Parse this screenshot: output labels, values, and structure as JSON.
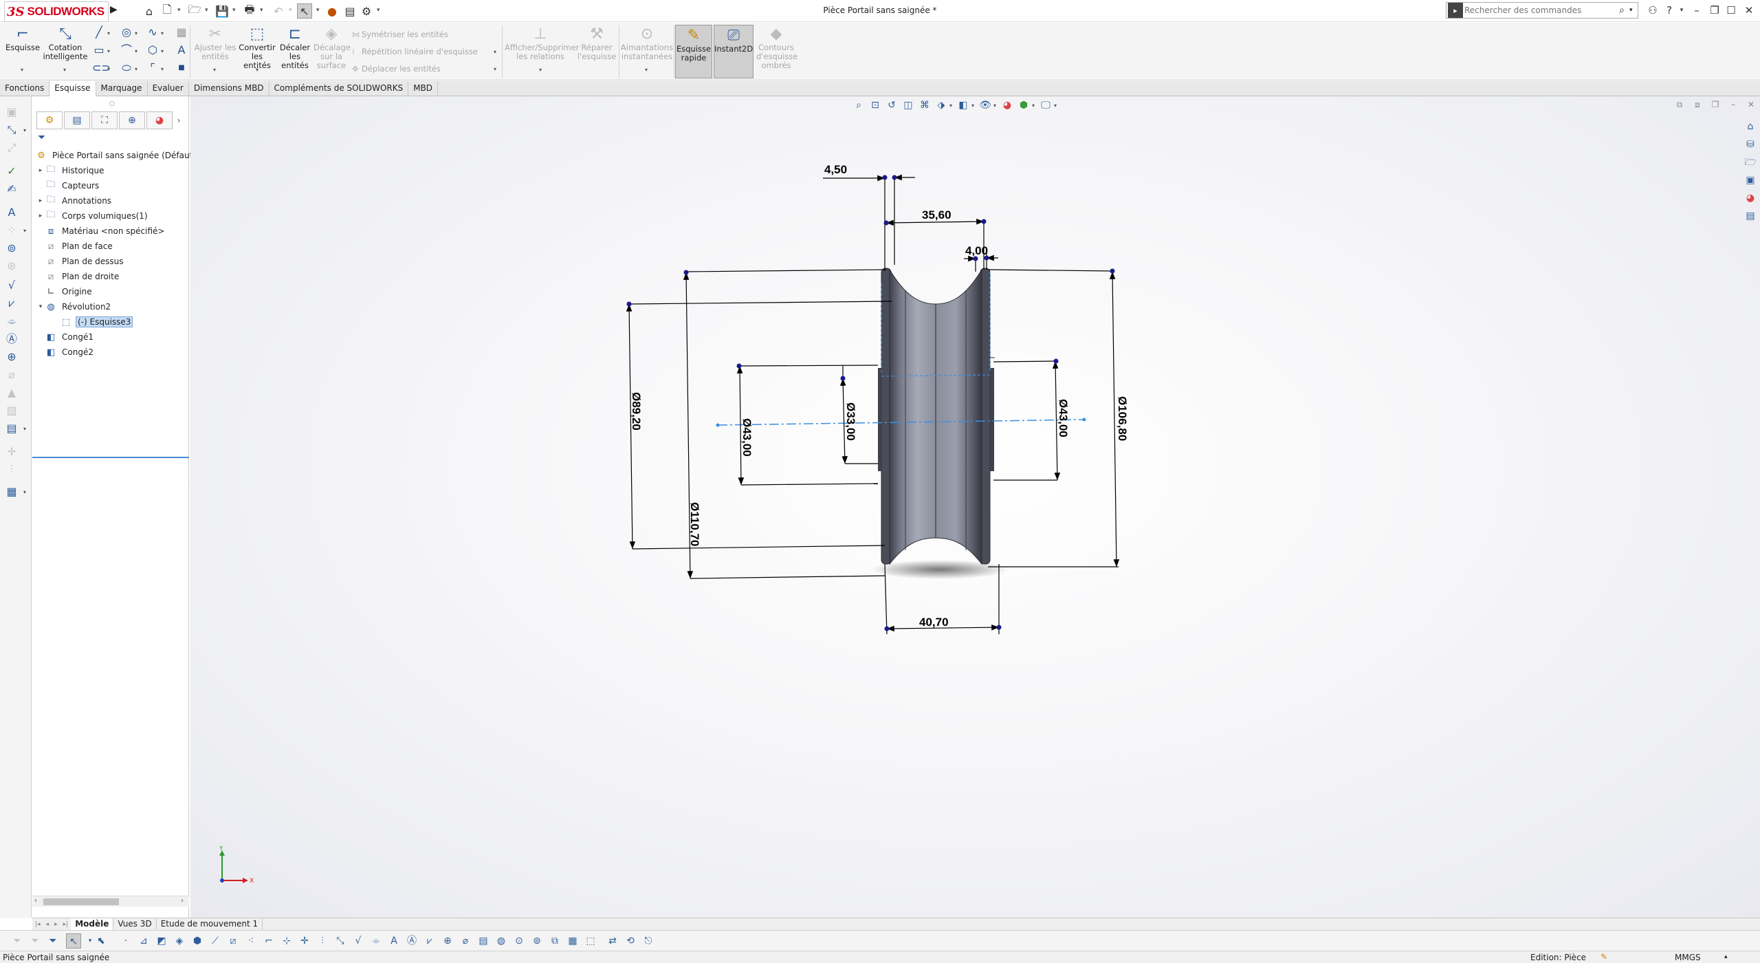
{
  "app": {
    "logo_ds": "3S",
    "logo_name": "SOLIDWORKS",
    "document_title": "Pièce Portail sans saignée *"
  },
  "search": {
    "placeholder": "Rechercher des commandes"
  },
  "ribbon": {
    "sketch": "Esquisse",
    "smart_dimension": [
      "Cotation",
      "intelligente"
    ],
    "trim": [
      "Ajuster les",
      "entités"
    ],
    "convert": [
      "Convertir",
      "les entités"
    ],
    "offset": [
      "Décaler",
      "les",
      "entités"
    ],
    "offset_surface": [
      "Décalage",
      "sur la",
      "surface"
    ],
    "mirror": "Symétriser les entités",
    "linear_pattern": "Répétition linéaire d'esquisse",
    "move": "Déplacer les entités",
    "show_relations": [
      "Afficher/Supprimer",
      "les relations"
    ],
    "repair": [
      "Réparer",
      "l'esquisse"
    ],
    "snaps": [
      "Aimantations",
      "instantanées"
    ],
    "rapid_sketch": [
      "Esquisse",
      "rapide"
    ],
    "instant2d": "Instant2D",
    "shaded_contours": [
      "Contours",
      "d'esquisse",
      "ombrés"
    ]
  },
  "cm_tabs": [
    "Fonctions",
    "Esquisse",
    "Marquage",
    "Evaluer",
    "Dimensions MBD",
    "Compléments de SOLIDWORKS",
    "MBD"
  ],
  "feature_tree": {
    "root": "Pièce Portail sans saignée  (Défaut<<D",
    "items": [
      {
        "label": "Historique"
      },
      {
        "label": "Capteurs"
      },
      {
        "label": "Annotations"
      },
      {
        "label": "Corps volumiques(1)"
      },
      {
        "label": "Matériau <non spécifié>"
      },
      {
        "label": "Plan de face"
      },
      {
        "label": "Plan de dessus"
      },
      {
        "label": "Plan de droite"
      },
      {
        "label": "Origine"
      },
      {
        "label": "Révolution2"
      },
      {
        "label": "(-) Esquisse3"
      },
      {
        "label": "Congé1"
      },
      {
        "label": "Congé2"
      }
    ]
  },
  "dimensions": {
    "d450": "4,50",
    "d3560": "35,60",
    "d400": "4,00",
    "d8920": "Ø89,20",
    "d11070": "Ø110,70",
    "d4300a": "Ø43,00",
    "d3300": "Ø33,00",
    "d4300b": "Ø43,00",
    "d10680": "Ø106,80",
    "d4070": "40,70"
  },
  "triad": {
    "x": "X",
    "y": "Y"
  },
  "bottom_tabs": [
    "Modèle",
    "Vues 3D",
    "Etude de mouvement 1"
  ],
  "status": {
    "left": "Pièce Portail sans saignée",
    "edit": "Edition: Pièce",
    "units": "MMGS"
  },
  "colors": {
    "brand": "#d6001c",
    "dimension": "#000000",
    "handle": "#1a1a8c",
    "centerline": "#3b8fe0",
    "body_dark": "#3f414c",
    "body_light": "#a6a9b6"
  }
}
